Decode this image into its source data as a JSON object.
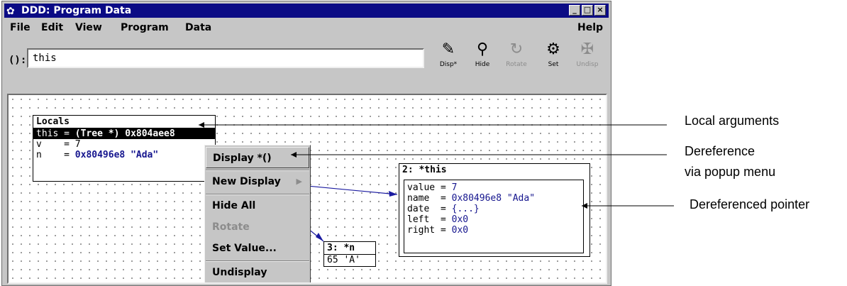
{
  "window": {
    "title": "DDD: Program Data",
    "controls": [
      "_",
      "□",
      "×"
    ]
  },
  "menubar": {
    "items": [
      "File",
      "Edit",
      "View",
      "Program",
      "Data"
    ],
    "help": "Help"
  },
  "argrow": {
    "label": "():",
    "value": "this"
  },
  "toolbar": [
    {
      "icon": "disp-icon",
      "label": "Disp*",
      "enabled": true
    },
    {
      "icon": "hide-icon",
      "label": "Hide",
      "enabled": true
    },
    {
      "icon": "rotate-icon",
      "label": "Rotate",
      "enabled": false
    },
    {
      "icon": "set-icon",
      "label": "Set",
      "enabled": true
    },
    {
      "icon": "undisp-icon",
      "label": "Undisp",
      "enabled": false
    }
  ],
  "locals": {
    "title": "Locals",
    "rows": [
      {
        "name": "this",
        "eq": " = ",
        "value": "(Tree *) 0x804aee8"
      },
      {
        "name": "v   ",
        "eq": " = ",
        "value": "7"
      },
      {
        "name": "n   ",
        "eq": " = ",
        "value": "0x80496e8 \"Ada\""
      }
    ]
  },
  "display_this": {
    "title": "2: *this",
    "rows": [
      {
        "name": "value",
        "eq": " = ",
        "value": "7"
      },
      {
        "name": "name ",
        "eq": " = ",
        "value": "0x80496e8 \"Ada\""
      },
      {
        "name": "date ",
        "eq": " = ",
        "value": "{...}"
      },
      {
        "name": "left ",
        "eq": " = ",
        "value": "0x0"
      },
      {
        "name": "right",
        "eq": " = ",
        "value": "0x0"
      }
    ]
  },
  "display_n": {
    "title": "3: *n",
    "value": "65 'A'"
  },
  "popup": {
    "items": [
      {
        "label": "Display *()",
        "enabled": true,
        "highlight": true
      },
      {
        "label": "New Display",
        "enabled": true,
        "submenu": true
      },
      {
        "label": "Hide All",
        "enabled": true
      },
      {
        "label": "Rotate",
        "enabled": false
      },
      {
        "label": "Set Value...",
        "enabled": true
      },
      {
        "label": "Undisplay",
        "enabled": true
      }
    ]
  },
  "annotations": {
    "local_arguments": "Local arguments",
    "dereference_line1": "Dereference",
    "dereference_line2": "via popup menu",
    "dereferenced_pointer": "Dereferenced pointer"
  },
  "colors": {
    "titlebar": "#0b0b85",
    "chrome": "#c6c6c6",
    "value_blue": "#15158e",
    "arrow_blue": "#1a1aa0"
  }
}
